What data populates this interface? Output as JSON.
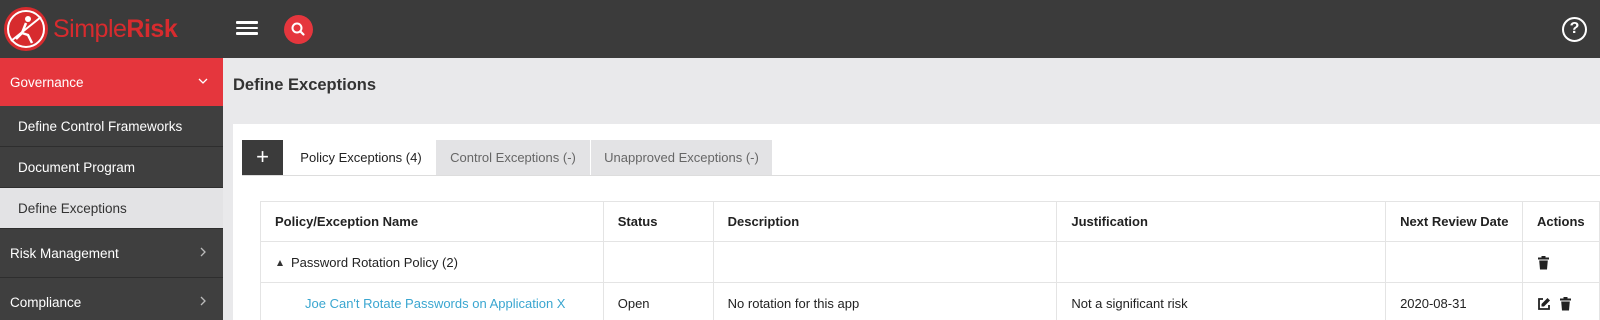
{
  "app": {
    "logo_text_light": "Simple",
    "logo_text_bold": "Risk",
    "brand_color": "#d72b2e",
    "help_label": "?"
  },
  "sidebar": {
    "sections": [
      {
        "label": "Governance",
        "expanded": true,
        "items": [
          {
            "label": "Define Control Frameworks"
          },
          {
            "label": "Document Program"
          },
          {
            "label": "Define Exceptions",
            "selected": true
          }
        ]
      },
      {
        "label": "Risk Management",
        "expanded": false
      },
      {
        "label": "Compliance",
        "expanded": false
      }
    ]
  },
  "main": {
    "page_title": "Define Exceptions",
    "add_button_label": "+",
    "tabs": [
      {
        "label": "Policy Exceptions (4)",
        "active": true
      },
      {
        "label": "Control Exceptions (-)",
        "active": false
      },
      {
        "label": "Unapproved Exceptions (-)",
        "active": false
      }
    ],
    "table": {
      "columns": [
        "Policy/Exception Name",
        "Status",
        "Description",
        "Justification",
        "Next Review Date",
        "Actions"
      ],
      "rows": [
        {
          "name": "Password Rotation Policy (2)",
          "type": "group",
          "status": "",
          "description": "",
          "justification": "",
          "next_review": "",
          "actions": [
            "delete-icon"
          ]
        },
        {
          "name": "Joe Can't Rotate Passwords on Application X",
          "type": "item",
          "status": "Open",
          "description": "No rotation for this app",
          "justification": "Not a significant risk",
          "next_review": "2020-08-31",
          "actions": [
            "edit-icon",
            "delete-icon"
          ]
        }
      ]
    }
  }
}
